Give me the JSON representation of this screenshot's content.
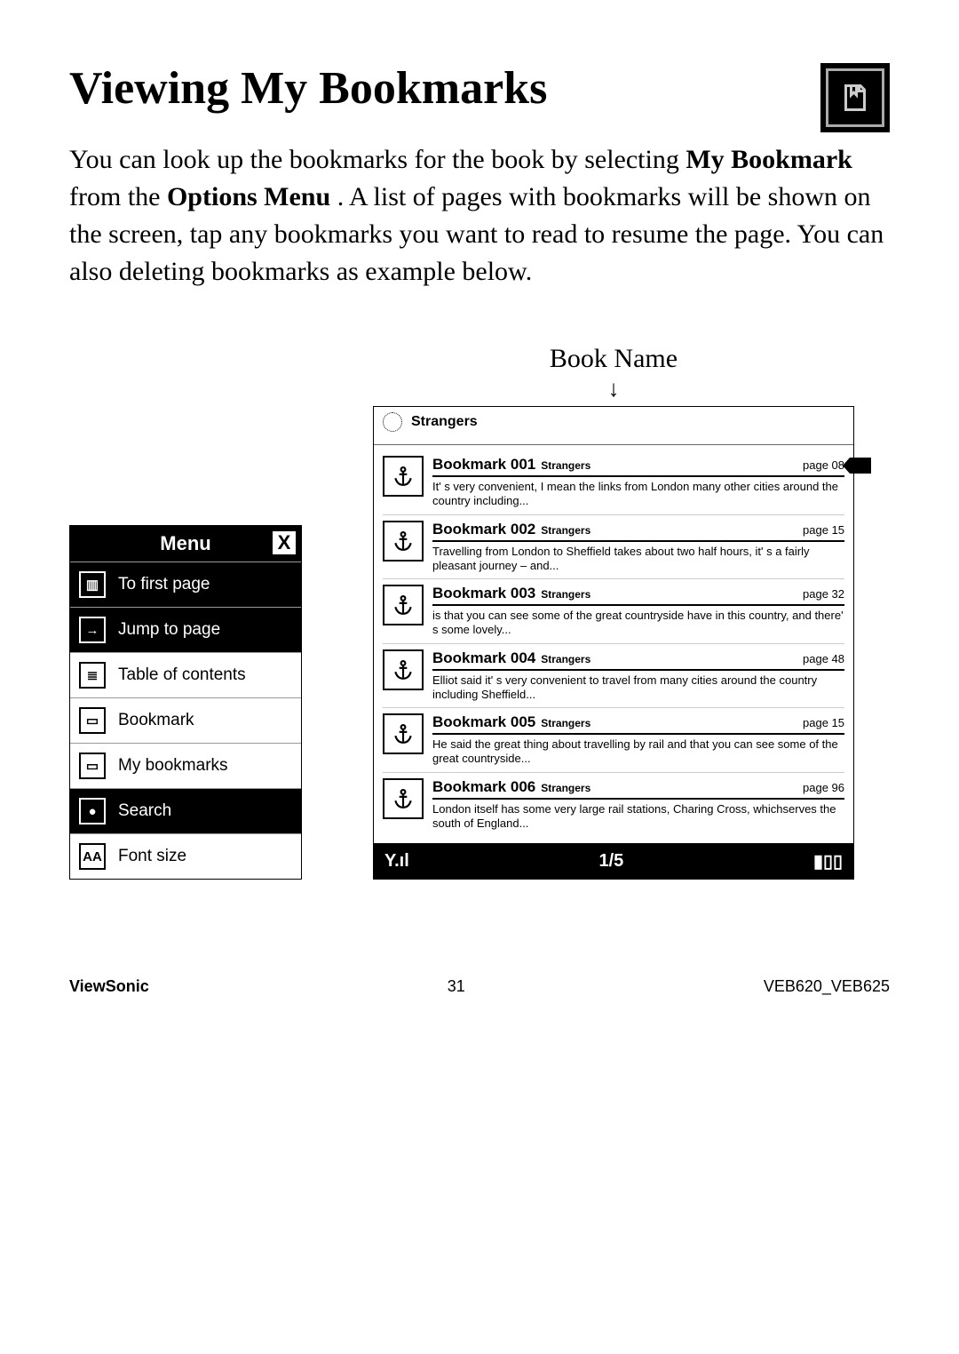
{
  "doc": {
    "title": "Viewing My Bookmarks",
    "paragraph_prefix": "You can look up the bookmarks for the book by selecting ",
    "my_bookmark_bold": "My Bookmark",
    "paragraph_mid1": " from the ",
    "options_menu_bold": "Options Menu",
    "paragraph_suffix": ". A list of pages with bookmarks will be shown on the screen, tap any bookmarks you want to read to resume the page. You can also deleting bookmarks as example below.",
    "book_name_label": "Book Name"
  },
  "menu": {
    "header": "Menu",
    "close_glyph": "X",
    "items": [
      {
        "label": "To first page",
        "dark": true,
        "glyph": "▥"
      },
      {
        "label": "Jump to page",
        "dark": true,
        "glyph": "→"
      },
      {
        "label": "Table of contents",
        "dark": false,
        "glyph": "≣"
      },
      {
        "label": "Bookmark",
        "dark": false,
        "glyph": "▭"
      },
      {
        "label": "My bookmarks",
        "dark": false,
        "glyph": "▭"
      },
      {
        "label": "Search",
        "dark": true,
        "glyph": "●"
      },
      {
        "label": "Font size",
        "dark": false,
        "glyph": "AA"
      }
    ]
  },
  "screen": {
    "book_title": "Strangers",
    "footer": {
      "signal_glyph": "Y.ıl",
      "pager": "1/5",
      "battery_glyph": "▮▯▯"
    },
    "bookmarks": [
      {
        "title": "Bookmark 001",
        "sub": "Strangers",
        "page": "page 08",
        "snippet": "It' s very convenient, I mean the links from London many other cities around the country including...",
        "has_delete": true
      },
      {
        "title": "Bookmark 002",
        "sub": "Strangers",
        "page": "page 15",
        "snippet": "Travelling from London to Sheffield takes about two half hours, it' s a fairly pleasant journey – and...",
        "has_delete": false
      },
      {
        "title": "Bookmark 003",
        "sub": "Strangers",
        "page": "page 32",
        "snippet": "is that you can see some of the great countryside have in this country, and there' s some lovely...",
        "has_delete": false
      },
      {
        "title": "Bookmark 004",
        "sub": "Strangers",
        "page": "page 48",
        "snippet": "Elliot said it' s very convenient to travel from many cities around the country including Sheffield...",
        "has_delete": false
      },
      {
        "title": "Bookmark 005",
        "sub": "Strangers",
        "page": "page 15",
        "snippet": "He said the great thing about travelling by rail and that you can see some of the great countryside...",
        "has_delete": false
      },
      {
        "title": "Bookmark 006",
        "sub": "Strangers",
        "page": "page 96",
        "snippet": "London itself has some very large rail stations, Charing Cross, whichserves the south of England...",
        "has_delete": false
      }
    ]
  },
  "footer": {
    "brand": "ViewSonic",
    "page_number": "31",
    "model": "VEB620_VEB625"
  }
}
